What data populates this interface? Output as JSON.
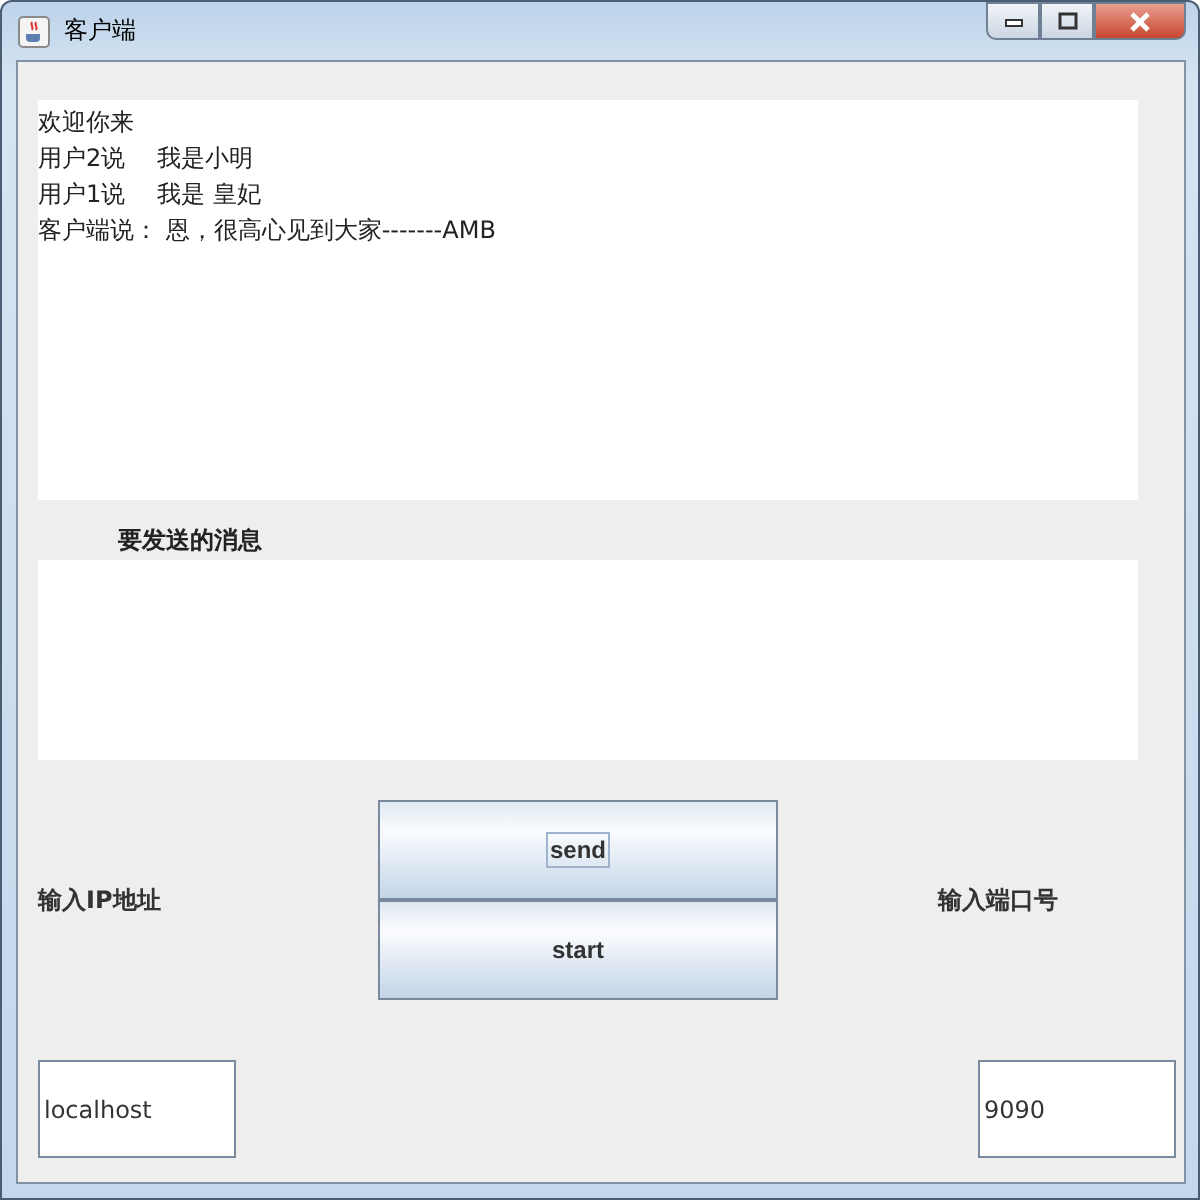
{
  "window": {
    "title": "客户端"
  },
  "chat": {
    "lines": [
      "欢迎你来",
      "用户2说　 我是小明",
      "用户1说　 我是 皇妃",
      "客户端说： 恩，很高心见到大家-------AMB"
    ]
  },
  "message_label": "要发送的消息",
  "buttons": [
    {
      "label": "send",
      "focused": true
    },
    {
      "label": "start",
      "focused": false
    }
  ],
  "ip_label": "输入IP地址",
  "ip_field": {
    "value": "localhost"
  },
  "port_label": "输入端口号",
  "port_field": {
    "value": "9090"
  }
}
